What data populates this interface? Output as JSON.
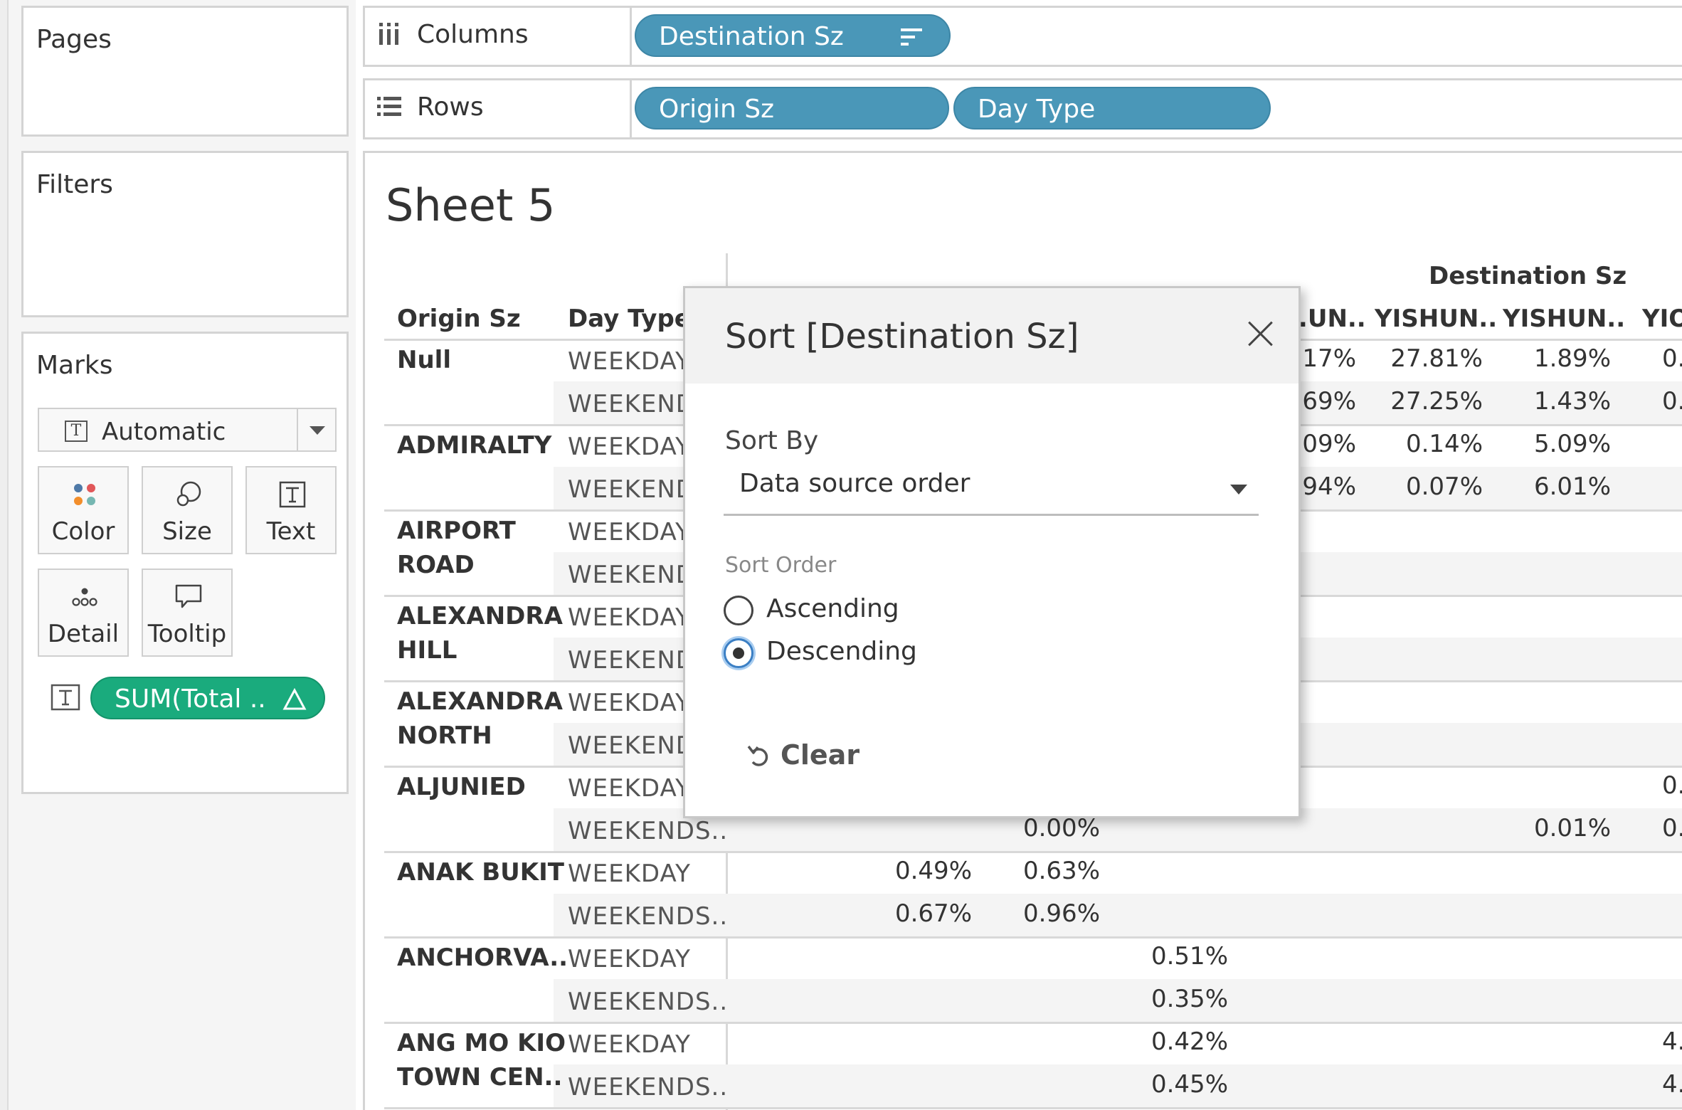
{
  "cards": {
    "pages": {
      "title": "Pages"
    },
    "filters": {
      "title": "Filters"
    },
    "marks": {
      "title": "Marks",
      "mark_type": "Automatic",
      "buttons": {
        "color": "Color",
        "size": "Size",
        "text": "Text",
        "detail": "Detail",
        "tooltip": "Tooltip"
      },
      "field_pill": "SUM(Total .."
    }
  },
  "shelves": {
    "columns": {
      "label": "Columns",
      "pills": [
        "Destination Sz"
      ]
    },
    "rows": {
      "label": "Rows",
      "pills": [
        "Origin Sz",
        "Day Type"
      ]
    }
  },
  "view": {
    "sheet_title": "Sheet 5",
    "headers": {
      "origin": "Origin Sz",
      "day_type": "Day Type",
      "destination": "Destination Sz"
    },
    "dest_columns": [
      "..UN..",
      "YISHUN..",
      "YISHUN..",
      "YIO"
    ],
    "rows": [
      {
        "origin": "Null",
        "day": "WEEKDAY",
        "v": [
          "..17%",
          "27.81%",
          "1.89%",
          "0."
        ]
      },
      {
        "origin": "",
        "day": "WEEKEND",
        "v": [
          "..69%",
          "27.25%",
          "1.43%",
          "0."
        ]
      },
      {
        "origin": "ADMIRALTY",
        "day": "WEEKDAY",
        "v": [
          "..09%",
          "0.14%",
          "5.09%",
          ""
        ]
      },
      {
        "origin": "",
        "day": "WEEKEND",
        "v": [
          "..94%",
          "0.07%",
          "6.01%",
          ""
        ]
      },
      {
        "origin": "AIRPORT",
        "day": "WEEKDAY"
      },
      {
        "origin": "ROAD",
        "day": "WEEKEND"
      },
      {
        "origin": "ALEXANDRA",
        "day": "WEEKDAY"
      },
      {
        "origin": "HILL",
        "day": "WEEKEND"
      },
      {
        "origin": "ALEXANDRA",
        "day": "WEEKDAY"
      },
      {
        "origin": "NORTH",
        "day": "WEEKEND"
      },
      {
        "origin": "ALJUNIED",
        "day": "WEEKDAY",
        "far": "0."
      },
      {
        "origin": "",
        "day": "WEEKENDS..",
        "c2": "0.00%",
        "c5": "0.01%",
        "far": "0."
      },
      {
        "origin": "ANAK BUKIT",
        "day": "WEEKDAY",
        "c1": "0.49%",
        "c2": "0.63%"
      },
      {
        "origin": "",
        "day": "WEEKENDS..",
        "c1": "0.67%",
        "c2": "0.96%"
      },
      {
        "origin": "ANCHORVA..",
        "day": "WEEKDAY",
        "c3": "0.51%"
      },
      {
        "origin": "",
        "day": "WEEKENDS..",
        "c3": "0.35%"
      },
      {
        "origin": "ANG MO KIO",
        "day": "WEEKDAY",
        "c3": "0.42%",
        "far": "4."
      },
      {
        "origin": "TOWN CEN..",
        "day": "WEEKENDS..",
        "c3": "0.45%",
        "far": "4."
      }
    ]
  },
  "sort_dialog": {
    "title": "Sort [Destination Sz]",
    "sort_by_label": "Sort By",
    "sort_by_value": "Data source order",
    "sort_order_label": "Sort Order",
    "options": [
      "Ascending",
      "Descending"
    ],
    "selected": "Descending",
    "clear_label": "Clear"
  },
  "colors": {
    "dimension_pill": "#4a97b8",
    "measure_pill": "#1aab7d",
    "focus_ring": "#3b7fc4"
  }
}
